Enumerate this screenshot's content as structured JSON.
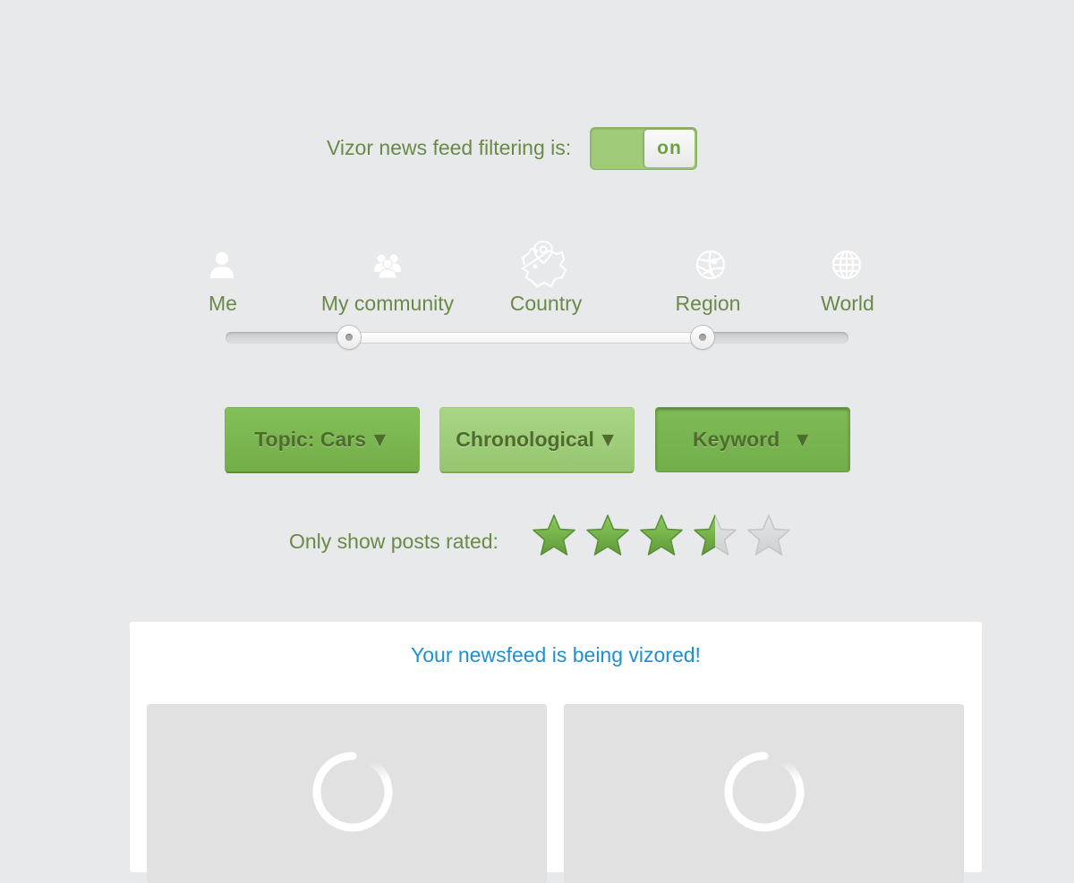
{
  "filter_toggle": {
    "label": "Vizor news feed filtering is:",
    "state_text": "on",
    "enabled": true,
    "accent_color": "#a0cb78"
  },
  "scope_slider": {
    "stops": [
      {
        "label": "Me",
        "icon": "user-icon"
      },
      {
        "label": "My community",
        "icon": "group-icon"
      },
      {
        "label": "Country",
        "icon": "country-map-pin-icon"
      },
      {
        "label": "Region",
        "icon": "region-globe-icon"
      },
      {
        "label": "World",
        "icon": "world-globe-icon"
      }
    ],
    "range_start": "My community",
    "range_end": "Region"
  },
  "dropdowns": {
    "topic": {
      "label": "Topic: Cars",
      "caret": "▼"
    },
    "sort": {
      "label": "Chronological",
      "caret": "▼"
    },
    "keyword": {
      "label": "Keyword",
      "caret": "▼"
    }
  },
  "rating": {
    "label": "Only show posts rated:",
    "value": 3.5,
    "max": 5,
    "filled_color": "#7bb94f",
    "empty_color": "#d8d9da"
  },
  "feed": {
    "title": "Your newsfeed is being vizored!",
    "title_color": "#1e8fcf",
    "cards": [
      {
        "status": "loading"
      },
      {
        "status": "loading"
      }
    ]
  }
}
